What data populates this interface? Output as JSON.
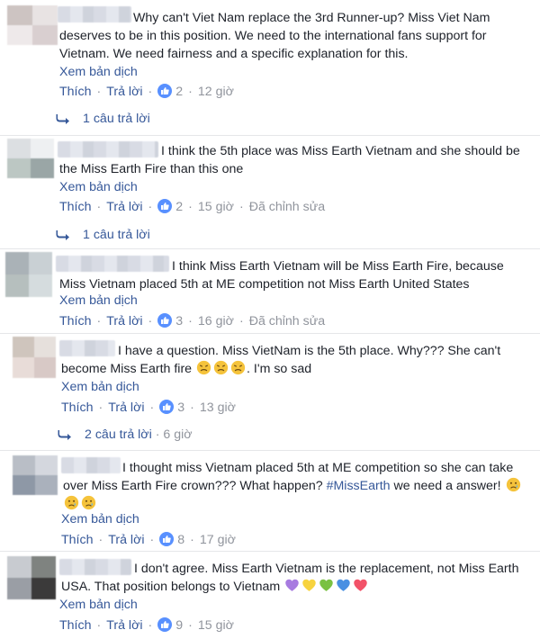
{
  "ui": {
    "see_translation": "Xem bản dịch",
    "like": "Thích",
    "reply": "Trả lời",
    "edited": "Đã chỉnh sửa",
    "accent_color": "#365899",
    "like_badge_color": "#5890ff"
  },
  "comments": [
    {
      "text": "Why can't Viet Nam replace the 3rd Runner-up? Miss Viet Nam deserves to be in this position. We need to the international fans support for Vietnam. We need fairness and a specific explanation for this.",
      "likes": "2",
      "time": "12 giờ",
      "replies": "1 câu trả lời"
    },
    {
      "text": "I think the 5th place was Miss Earth Vietnam and she should be the Miss Earth Fire than this one",
      "likes": "2",
      "time": "15 giờ",
      "replies": "1 câu trả lời"
    },
    {
      "text": "I think Miss Earth Vietnam will be Miss Earth Fire, because Miss Vietnam placed 5th at ME competition not Miss Earth United States",
      "likes": "3",
      "time": "16 giờ"
    },
    {
      "text_a": "I have a question. Miss VietNam is the 5th place. Why??? She can't become Miss Earth fire",
      "text_b": ". I'm so sad",
      "emojis": [
        "persevering-face",
        "persevering-face",
        "persevering-face"
      ],
      "likes": "3",
      "time": "13 giờ",
      "replies": "2 câu trả lời",
      "replies_time": "6 giờ"
    },
    {
      "text_a": "I thought miss Vietnam placed 5th at ME competition so she can take over Miss Earth Fire crown??? What happen?",
      "hashtag": "#MissEarth",
      "text_b": "we need a answer!",
      "emojis": [
        "crying-face",
        "crying-face",
        "crying-face"
      ],
      "likes": "8",
      "time": "17 giờ"
    },
    {
      "text": "I don't agree. Miss Earth Vietnam is the replacement, not Miss Earth USA. That position belongs to Vietnam",
      "hearts": [
        "purple-heart",
        "yellow-heart",
        "green-heart",
        "blue-heart",
        "red-heart"
      ],
      "heart_colors": [
        "#a77be0",
        "#f7d33e",
        "#7ac142",
        "#4a90e2",
        "#f25268"
      ],
      "likes": "9",
      "time": "15 giờ"
    }
  ]
}
